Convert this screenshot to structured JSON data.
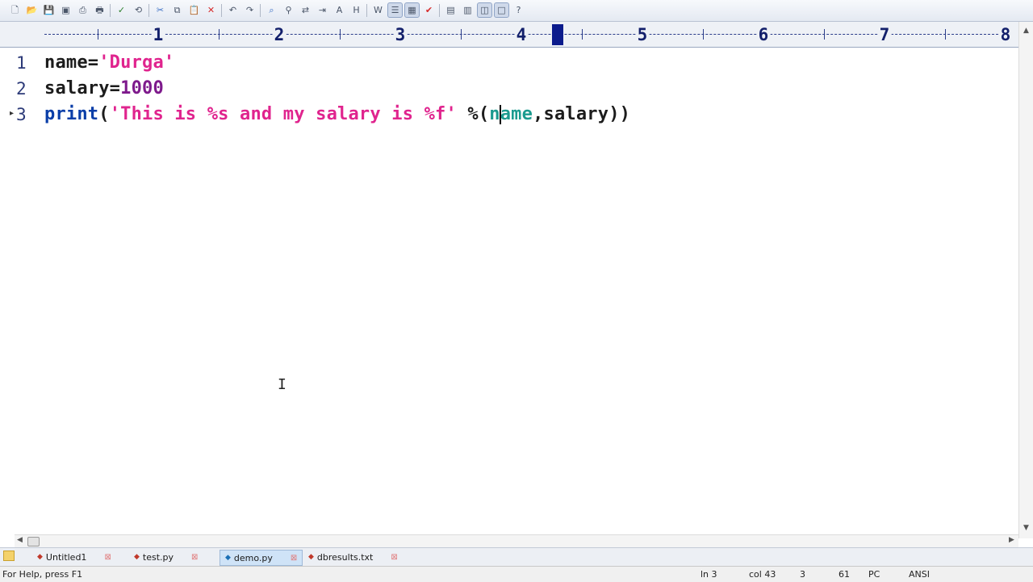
{
  "toolbar": {
    "buttons": [
      "new-file-icon",
      "open-folder-icon",
      "save-icon",
      "save-all-icon",
      "print-preview-icon",
      "print-icon",
      "spell-check-icon",
      "format-icon",
      "cut-icon",
      "copy-icon",
      "paste-icon",
      "delete-icon",
      "undo-icon",
      "redo-icon",
      "find-icon",
      "find-in-files-icon",
      "replace-icon",
      "goto-icon",
      "font-icon",
      "hex-icon",
      "word-wrap-icon",
      "list-icon",
      "column-icon",
      "check-icon",
      "window-tile-icon",
      "window-cascade-icon",
      "window-split-icon",
      "window-max-icon",
      "help-icon"
    ]
  },
  "ruler": {
    "labels": [
      "1",
      "2",
      "3",
      "4",
      "5",
      "6",
      "7",
      "8"
    ]
  },
  "editor": {
    "lines": [
      {
        "number": "1",
        "tokens": [
          {
            "text": "name=",
            "cls": "tk-name"
          },
          {
            "text": "'Durga'",
            "cls": "tk-str"
          }
        ]
      },
      {
        "number": "2",
        "tokens": [
          {
            "text": "salary=",
            "cls": "tk-name"
          },
          {
            "text": "1000",
            "cls": "tk-num"
          }
        ]
      },
      {
        "number": "3",
        "tokens": [
          {
            "text": "print",
            "cls": "tk-kw"
          },
          {
            "text": "(",
            "cls": "tk-plain"
          },
          {
            "text": "'This is %s and my salary is %f'",
            "cls": "tk-str"
          },
          {
            "text": " %(",
            "cls": "tk-plain"
          },
          {
            "text": "n",
            "cls": "tk-id"
          },
          {
            "text": "|caret|",
            "cls": "caret"
          },
          {
            "text": "ame",
            "cls": "tk-id"
          },
          {
            "text": ",salary))",
            "cls": "tk-plain"
          }
        ]
      }
    ]
  },
  "tabs": [
    {
      "label": "Untitled1",
      "active": false
    },
    {
      "label": "test.py",
      "active": false
    },
    {
      "label": "demo.py",
      "active": true
    },
    {
      "label": "dbresults.txt",
      "active": false
    }
  ],
  "status": {
    "help": "For Help, press F1",
    "line": "ln 3",
    "col": "col 43",
    "sel": "3",
    "num": "61",
    "mode": "PC",
    "encoding": "ANSI"
  }
}
